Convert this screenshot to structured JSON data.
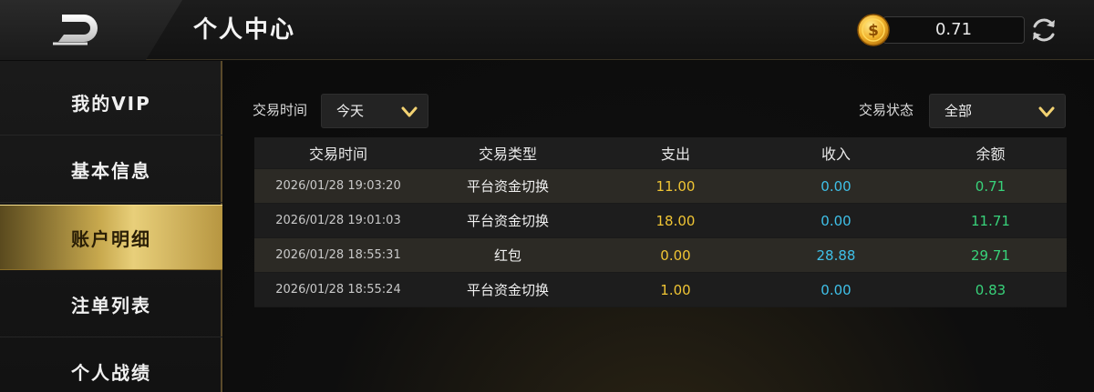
{
  "header": {
    "title": "个人中心",
    "balance": "0.71",
    "icons": {
      "back": "back-icon",
      "coin": "coin-icon",
      "refresh": "refresh-icon"
    }
  },
  "sidebar": {
    "items": [
      {
        "label": "我的VIP",
        "active": false
      },
      {
        "label": "基本信息",
        "active": false
      },
      {
        "label": "账户明细",
        "active": true
      },
      {
        "label": "注单列表",
        "active": false
      },
      {
        "label": "个人战绩",
        "active": false
      }
    ]
  },
  "filters": {
    "time_label": "交易时间",
    "time_value": "今天",
    "status_label": "交易状态",
    "status_value": "全部"
  },
  "table": {
    "columns": [
      "交易时间",
      "交易类型",
      "支出",
      "收入",
      "余额"
    ],
    "rows": [
      [
        "2026/01/28 19:03:20",
        "平台资金切换",
        "11.00",
        "0.00",
        "0.71"
      ],
      [
        "2026/01/28 19:01:03",
        "平台资金切换",
        "18.00",
        "0.00",
        "11.71"
      ],
      [
        "2026/01/28 18:55:31",
        "红包",
        "0.00",
        "28.88",
        "29.71"
      ],
      [
        "2026/01/28 18:55:24",
        "平台资金切换",
        "1.00",
        "0.00",
        "0.83"
      ]
    ]
  },
  "colors": {
    "accent_gold": "#e8cf7a",
    "expense": "#f0c534",
    "income": "#3fc0e8",
    "balance": "#38d27a"
  }
}
